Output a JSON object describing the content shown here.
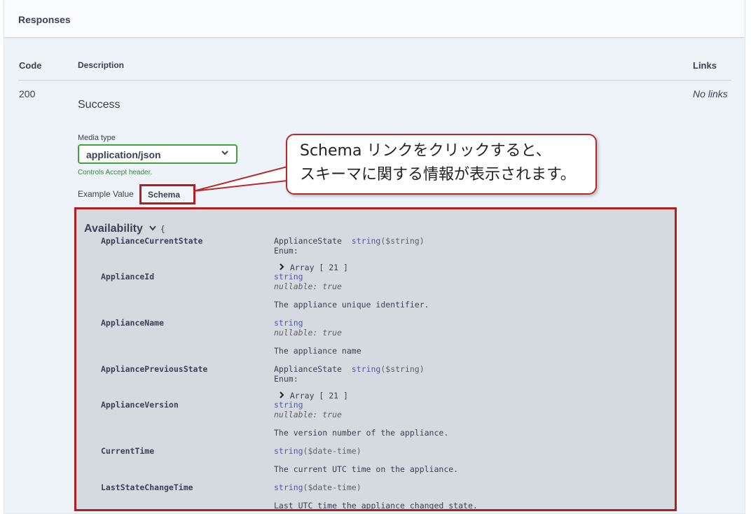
{
  "responses": {
    "title": "Responses",
    "columns": {
      "code": "Code",
      "description": "Description",
      "links": "Links"
    },
    "row": {
      "code": "200",
      "description": "Success",
      "links": "No links",
      "media_type_label": "Media type",
      "media_type_value": "application/json",
      "controls_note": "Controls Accept header.",
      "example_value_label": "Example Value",
      "schema_tab_label": "Schema"
    }
  },
  "callout": {
    "line1": "Schema リンクをクリックすると、",
    "line2": "スキーマに関する情報が表示されます。"
  },
  "model": {
    "name": "Availability",
    "open_brace": "{",
    "properties": [
      {
        "name": "ApplianceCurrentState",
        "ref": "ApplianceState",
        "type": "string",
        "format": "($string)",
        "enum_label": "Enum:",
        "array_label": "Array [ 21 ]"
      },
      {
        "name": "ApplianceId",
        "type": "string",
        "nullable": "nullable: true",
        "description": "The appliance unique identifier."
      },
      {
        "name": "ApplianceName",
        "type": "string",
        "nullable": "nullable: true",
        "description": "The appliance name"
      },
      {
        "name": "AppliancePreviousState",
        "ref": "ApplianceState",
        "type": "string",
        "format": "($string)",
        "enum_label": "Enum:",
        "array_label": "Array [ 21 ]"
      },
      {
        "name": "ApplianceVersion",
        "type": "string",
        "nullable": "nullable: true",
        "description": "The version number of the appliance."
      },
      {
        "name": "CurrentTime",
        "type": "string",
        "format": "($date-time)",
        "description": "The current UTC time on the appliance."
      },
      {
        "name": "LastStateChangeTime",
        "type": "string",
        "format": "($date-time)",
        "description": "Last UTC time the appliance changed state."
      }
    ]
  },
  "colors": {
    "accent_green": "#41a33e",
    "annotation_red": "#b21f1f",
    "type_blue": "#5555aa"
  },
  "icons": {
    "media_select": "chevron-down-icon",
    "model_toggle": "chevron-down-icon",
    "array_toggle": "chevron-right-icon"
  }
}
